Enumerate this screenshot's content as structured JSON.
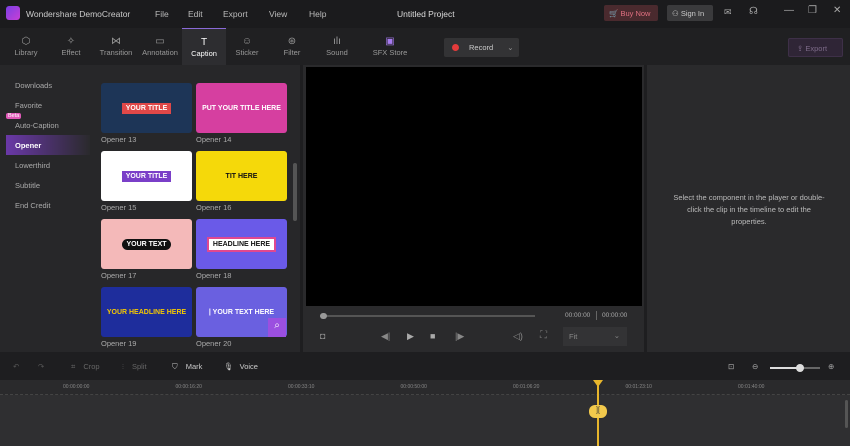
{
  "app": {
    "name": "Wondershare DemoCreator",
    "project": "Untitled Project"
  },
  "menu": [
    "File",
    "Edit",
    "Export",
    "View",
    "Help"
  ],
  "header": {
    "buy": "Buy Now",
    "signin": "Sign In"
  },
  "tools": [
    {
      "label": "Library",
      "icon": "⬡"
    },
    {
      "label": "Effect",
      "icon": "✧"
    },
    {
      "label": "Transition",
      "icon": "⋈"
    },
    {
      "label": "Annotation",
      "icon": "▭"
    },
    {
      "label": "Caption",
      "icon": "T"
    },
    {
      "label": "Sticker",
      "icon": "☺"
    },
    {
      "label": "Filter",
      "icon": "⊛"
    },
    {
      "label": "Sound",
      "icon": "ılı"
    },
    {
      "label": "SFX Store",
      "icon": "▣"
    }
  ],
  "record": "Record",
  "export": "Export",
  "sidebar": {
    "items": [
      "Downloads",
      "Favorite",
      "Auto-Caption",
      "Opener",
      "Lowerthird",
      "Subtitle",
      "End Credit"
    ],
    "beta": "Beta",
    "active": "Opener"
  },
  "thumbs": [
    {
      "label": "Opener 13",
      "text": "YOUR TITLE",
      "bg": "#1d3557",
      "fg": "#fff"
    },
    {
      "label": "Opener 14",
      "text": "PUT YOUR  TITLE HERE",
      "bg": "#d63fa0",
      "fg": "#fff"
    },
    {
      "label": "Opener 15",
      "text": "YOUR TITLE",
      "bg": "#ffffff",
      "fg": "#7a3fc8"
    },
    {
      "label": "Opener 16",
      "text": "TIT HERE",
      "bg": "#f5d90a",
      "fg": "#111"
    },
    {
      "label": "Opener 17",
      "text": "YOUR TEXT",
      "bg": "#f4b9b9",
      "fg": "#fff"
    },
    {
      "label": "Opener 18",
      "text": "HEADLINE HERE",
      "bg": "#6a5ae8",
      "fg": "#111"
    },
    {
      "label": "Opener 19",
      "text": "YOUR HEADLINE HERE",
      "bg": "#1e2d9c",
      "fg": "#f5c800"
    },
    {
      "label": "Opener 20",
      "text": "| YOUR TEXT HERE",
      "bg": "#6a60e0",
      "fg": "#fff"
    }
  ],
  "player": {
    "current": "00:00:00",
    "total": "00:00:00",
    "fit": "Fit"
  },
  "props": "Select the component in the player or double-click the clip in the timeline to edit the properties.",
  "timeline": {
    "crop": "Crop",
    "split": "Split",
    "mark": "Mark",
    "voice": "Voice",
    "ticks": [
      "00:00:00:00",
      "00:00:16:20",
      "00:00:33:10",
      "00:00:50:00",
      "00:01:06:20",
      "00:01:23:10",
      "00:01:40:00"
    ],
    "zoom": 0.6
  }
}
